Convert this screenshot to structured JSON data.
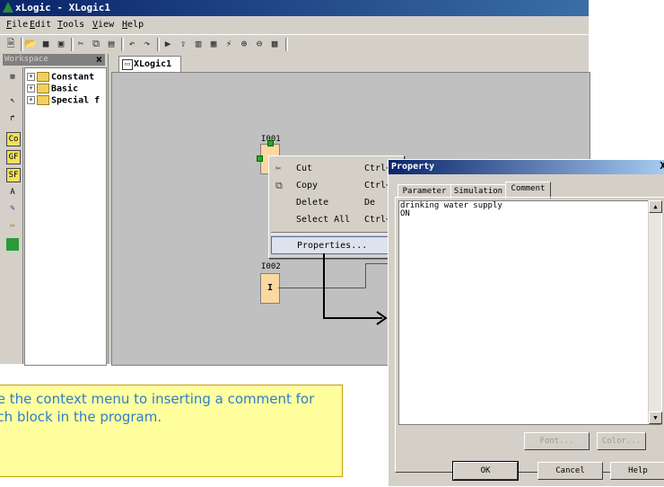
{
  "window": {
    "title": "xLogic - XLogic1"
  },
  "menu": [
    {
      "key": "F",
      "rest": "ile",
      "label": "File"
    },
    {
      "key": "E",
      "rest": "dit",
      "label": "Edit"
    },
    {
      "key": "T",
      "rest": "ools",
      "label": "Tools"
    },
    {
      "key": "V",
      "rest": "iew",
      "label": "View"
    },
    {
      "key": "H",
      "rest": "elp",
      "label": "Help"
    }
  ],
  "workspace": {
    "title": "Workspace",
    "close": "×",
    "tree": [
      "Constant",
      "Basic",
      "Special f"
    ],
    "palette": [
      "Co",
      "GF",
      "SF"
    ]
  },
  "document": {
    "tab": "XLogic1"
  },
  "blocks": [
    {
      "name": "I001",
      "symbol": ""
    },
    {
      "name": "I002",
      "symbol": "I"
    }
  ],
  "context_menu": {
    "items": [
      {
        "label": "Cut",
        "shortcut": "Ctrl+"
      },
      {
        "label": "Copy",
        "shortcut": "Ctrl+"
      },
      {
        "label": "Delete",
        "shortcut": "De"
      },
      {
        "label": "Select All",
        "shortcut": "Ctrl+"
      },
      {
        "label": "Properties...",
        "shortcut": ""
      }
    ]
  },
  "property_dialog": {
    "title": "Property",
    "close": "X",
    "tabs": [
      "Parameter",
      "Simulation",
      "Comment"
    ],
    "active_tab": "Comment",
    "comment_text": "drinking water supply\nON",
    "buttons": {
      "font": "Font...",
      "color": "Color...",
      "ok": "OK",
      "cancel": "Cancel",
      "help": "Help"
    }
  },
  "callout": {
    "text": "Use the context menu to inserting a comment for each block in the program."
  }
}
